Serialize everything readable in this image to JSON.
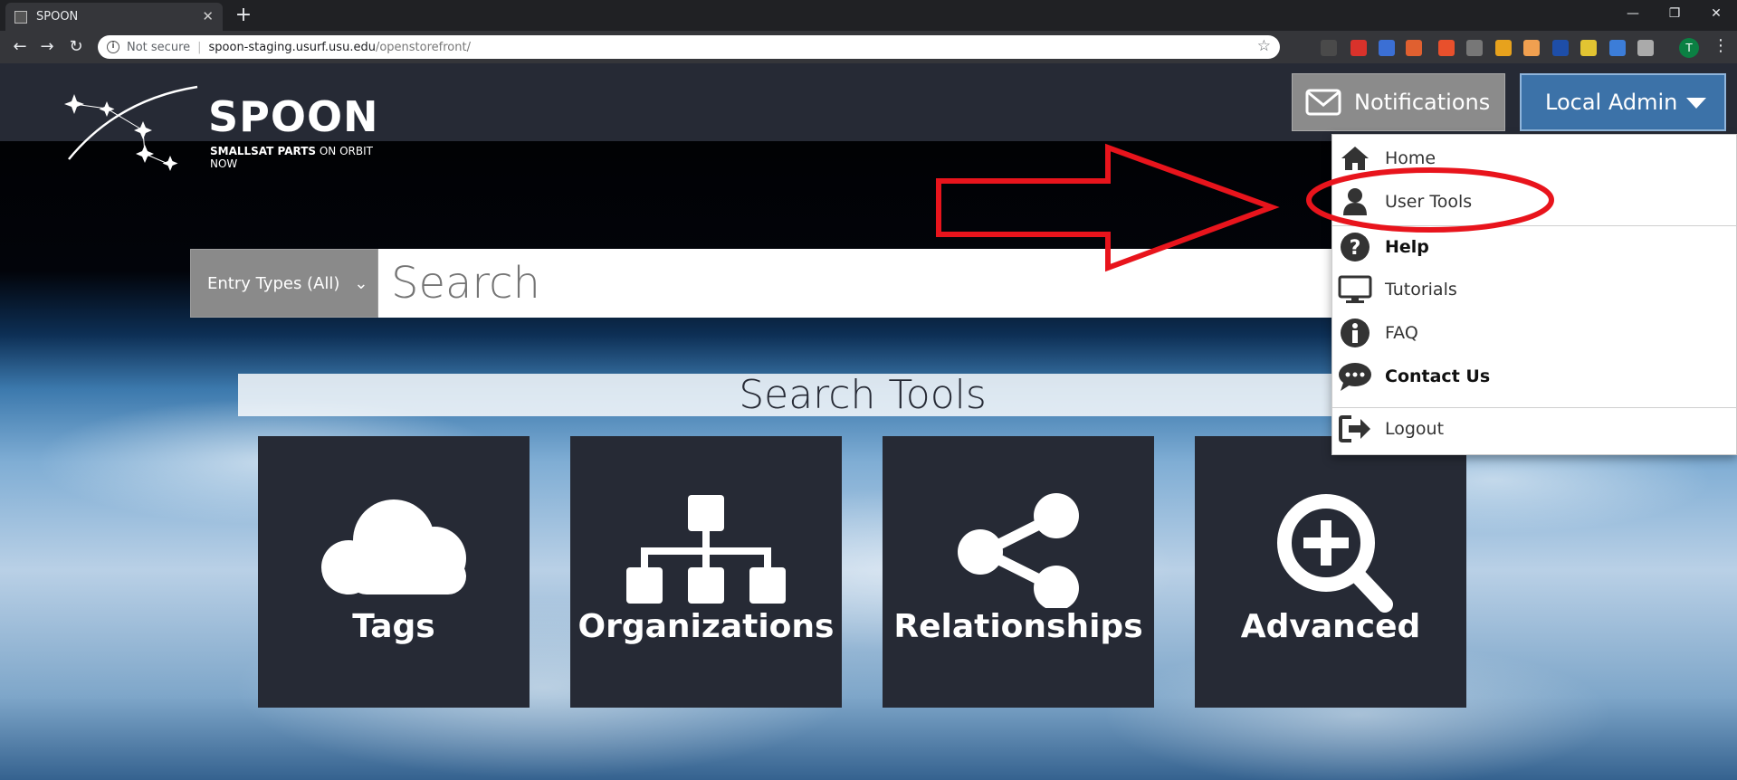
{
  "browser": {
    "tab_title": "SPOON",
    "tab_close": "✕",
    "new_tab": "+",
    "security_label": "Not secure",
    "url_host": "spoon-staging.usurf.usu.edu",
    "url_path": "/openstorefront/",
    "profile_initial": "T",
    "window_controls": {
      "minimize": "—",
      "restore": "❐",
      "close": "✕"
    }
  },
  "header": {
    "logo_title": "SPOON",
    "logo_subtitle_bold": "SMALLSAT PARTS",
    "logo_subtitle_rest": " ON ORBIT NOW",
    "notifications_label": "Notifications",
    "user_menu_label": "Local Admin"
  },
  "search": {
    "entry_types_label": "Entry Types (All)",
    "placeholder": "Search"
  },
  "tools": {
    "title": "Search Tools",
    "cards": [
      {
        "label": "Tags",
        "icon": "cloud-icon"
      },
      {
        "label": "Organizations",
        "icon": "org-chart-icon"
      },
      {
        "label": "Relationships",
        "icon": "share-icon"
      },
      {
        "label": "Advanced",
        "icon": "search-plus-icon"
      }
    ]
  },
  "user_menu": {
    "items": [
      {
        "label": "Home",
        "icon": "home-icon",
        "bold": false
      },
      {
        "label": "User Tools",
        "icon": "user-icon",
        "bold": false
      },
      {
        "label": "Help",
        "icon": "question-icon",
        "bold": true
      },
      {
        "label": "Tutorials",
        "icon": "monitor-icon",
        "bold": false
      },
      {
        "label": "FAQ",
        "icon": "info-icon",
        "bold": false
      },
      {
        "label": "Contact Us",
        "icon": "chat-icon",
        "bold": true
      },
      {
        "label": "Logout",
        "icon": "logout-icon",
        "bold": false
      }
    ]
  },
  "colors": {
    "header_bg": "#262a35",
    "admin_button": "#3c72a8",
    "notification_button": "#8b8b8b",
    "annotation_red": "#e8141c"
  }
}
